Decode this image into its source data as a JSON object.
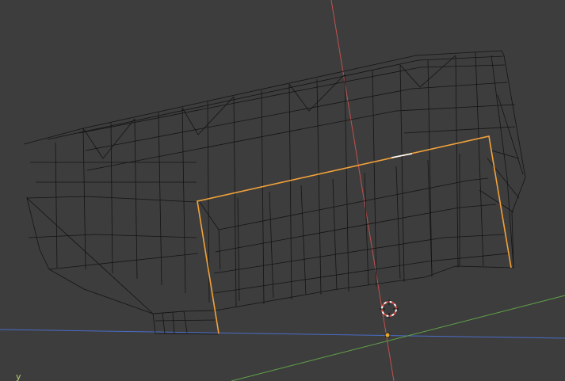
{
  "viewport": {
    "axis_indicator_label": "y",
    "colors": {
      "background": "#3d3d3d",
      "wire": "#141414",
      "selected_edge": "#f2a23a",
      "x_axis": "#c0524e",
      "y_axis": "#5fa348",
      "z_axis": "#4a6cc7",
      "cursor_red": "#e14c43",
      "cursor_white": "#ffffff",
      "origin": "#e3a82d"
    },
    "icons": [
      "3d-cursor-icon",
      "origin-dot-icon"
    ]
  }
}
